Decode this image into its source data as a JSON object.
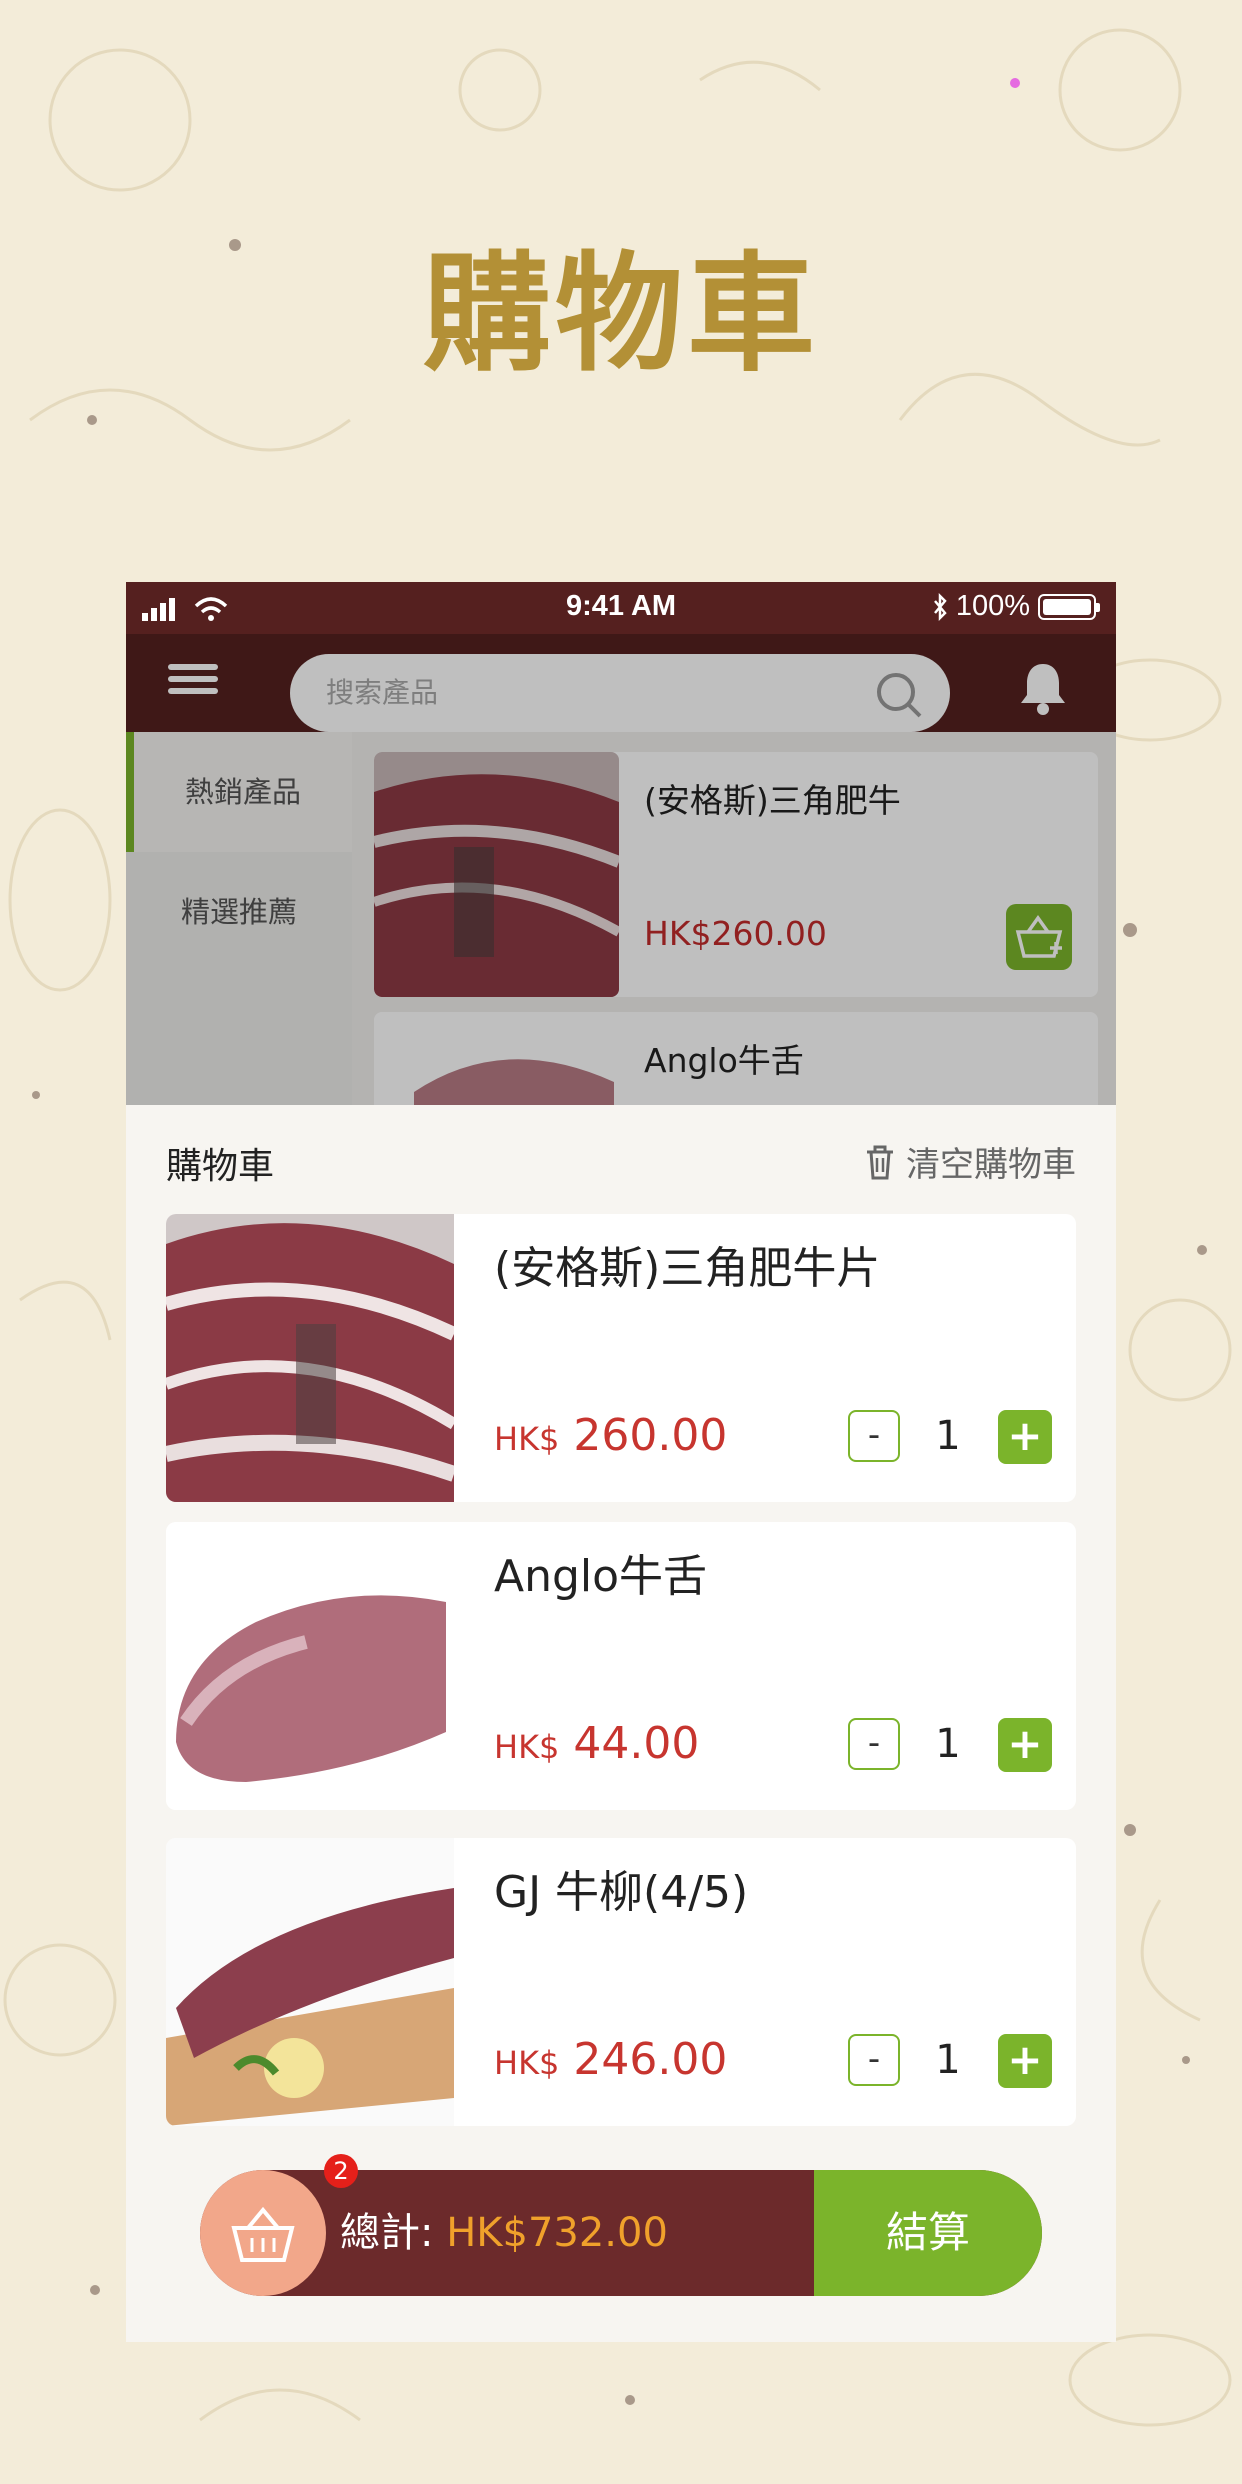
{
  "promo": {
    "title": "購物車"
  },
  "status_bar": {
    "time": "9:41 AM",
    "battery": "100%",
    "battery_level": 1.0
  },
  "header": {
    "search_placeholder": "搜索產品"
  },
  "categories": [
    {
      "label": "熱銷產品",
      "active": true
    },
    {
      "label": "精選推薦",
      "active": false
    }
  ],
  "products": [
    {
      "name": "(安格斯)三角肥牛",
      "price": "HK$260.00"
    },
    {
      "name": "Anglo牛舌",
      "price": ""
    }
  ],
  "cart": {
    "title": "購物車",
    "clear_label": "清空購物車",
    "currency": "HK$",
    "items": [
      {
        "name": "(安格斯)三角肥牛片",
        "price": "260.00",
        "qty": "1",
        "minus": "-",
        "plus": "+"
      },
      {
        "name": "Anglo牛舌",
        "price": "44.00",
        "qty": "1",
        "minus": "-",
        "plus": "+"
      },
      {
        "name": "GJ 牛柳(4/5)",
        "price": "246.00",
        "qty": "1",
        "minus": "-",
        "plus": "+"
      }
    ],
    "badge_count": "2",
    "total_label": "總計:",
    "total_value": "HK$732.00",
    "checkout_label": "結算"
  },
  "colors": {
    "brand_maroon": "#55201f",
    "accent_green": "#7bb42b",
    "price_red": "#c7352f",
    "total_orange": "#f0a12b",
    "promo_gold": "#b39036"
  },
  "icons": [
    "hamburger-icon",
    "search-icon",
    "bell-icon",
    "add-to-basket-icon",
    "trash-icon",
    "basket-icon",
    "wifi-icon",
    "signal-icon",
    "bluetooth-icon",
    "battery-icon"
  ]
}
